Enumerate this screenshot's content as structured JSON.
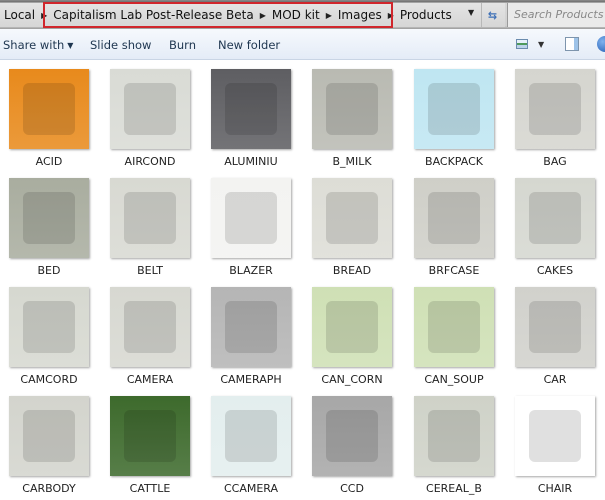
{
  "address_bar": {
    "crumbs": [
      "Local",
      "Capitalism Lab Post-Release Beta",
      "MOD kit",
      "Images",
      "Products"
    ],
    "search_placeholder": "Search Products",
    "highlight_color": "#d0262c"
  },
  "toolbar": {
    "share_with": "Share with",
    "slide_show": "Slide show",
    "burn": "Burn",
    "new_folder": "New folder"
  },
  "icons": {
    "view": "change-view-icon",
    "preview_pane": "preview-pane-icon",
    "help": "help-icon",
    "refresh": "refresh-icon"
  },
  "files": [
    {
      "name": "ACID",
      "bg": "#e88a1c"
    },
    {
      "name": "AIRCOND",
      "bg": "#d9dbd5"
    },
    {
      "name": "ALUMINIU",
      "bg": "#5e5e62"
    },
    {
      "name": "B_MILK",
      "bg": "#b9bab2"
    },
    {
      "name": "BACKPACK",
      "bg": "#bfe6f2"
    },
    {
      "name": "BAG",
      "bg": "#d5d5cf"
    },
    {
      "name": "BED",
      "bg": "#a9ad9f"
    },
    {
      "name": "BELT",
      "bg": "#d8d9d2"
    },
    {
      "name": "BLAZER",
      "bg": "#f3f3f1"
    },
    {
      "name": "BREAD",
      "bg": "#ddddd6"
    },
    {
      "name": "BRFCASE",
      "bg": "#cfcfc8"
    },
    {
      "name": "CAKES",
      "bg": "#d5d7d0"
    },
    {
      "name": "CAMCORD",
      "bg": "#d6d8d0"
    },
    {
      "name": "CAMERA",
      "bg": "#d7d8d1"
    },
    {
      "name": "CAMERAPH",
      "bg": "#b5b5b5"
    },
    {
      "name": "CAN_CORN",
      "bg": "#cfe0b5"
    },
    {
      "name": "CAN_SOUP",
      "bg": "#cfe0b5"
    },
    {
      "name": "CAR",
      "bg": "#d1d1cc"
    },
    {
      "name": "CARBODY",
      "bg": "#d3d4cd"
    },
    {
      "name": "CATTLE",
      "bg": "#3d6a2c"
    },
    {
      "name": "CCAMERA",
      "bg": "#e3eeee"
    },
    {
      "name": "CCD",
      "bg": "#a7a7a7"
    },
    {
      "name": "CEREAL_B",
      "bg": "#cfd2c8"
    },
    {
      "name": "CHAIR",
      "bg": "#ffffff"
    }
  ]
}
